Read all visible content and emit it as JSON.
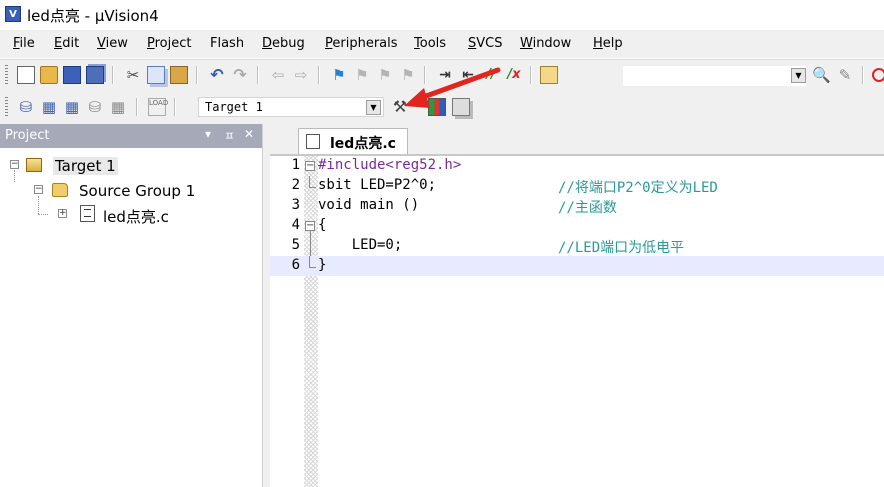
{
  "window": {
    "title": "led点亮 - µVision4",
    "icon_letter": "V"
  },
  "menu": [
    {
      "label": "File",
      "u": "F",
      "rest": "ile"
    },
    {
      "label": "Edit",
      "u": "E",
      "rest": "dit"
    },
    {
      "label": "View",
      "u": "V",
      "rest": "iew"
    },
    {
      "label": "Project",
      "u": "P",
      "rest": "roject"
    },
    {
      "label": "Flash",
      "u": "",
      "rest": "Flash"
    },
    {
      "label": "Debug",
      "u": "D",
      "rest": "ebug"
    },
    {
      "label": "Peripherals",
      "u": "P",
      "rest": "eripherals"
    },
    {
      "label": "Tools",
      "u": "T",
      "rest": "ools"
    },
    {
      "label": "SVCS",
      "u": "S",
      "rest": "VCS"
    },
    {
      "label": "Window",
      "u": "W",
      "rest": "indow"
    },
    {
      "label": "Help",
      "u": "H",
      "rest": "elp"
    }
  ],
  "toolbar2": {
    "target_value": "Target 1",
    "load_label": "LOAD"
  },
  "project_panel": {
    "title": "Project",
    "controls": {
      "menu": "▾",
      "pin": "ㅍ",
      "close": "✕"
    },
    "tree": {
      "target": "Target 1",
      "group": "Source Group 1",
      "file": "led点亮.c"
    }
  },
  "editor": {
    "tab": "led点亮.c",
    "current_line": 6,
    "lines": [
      {
        "num": "1",
        "code": "#include<reg52.h>",
        "comment": ""
      },
      {
        "num": "2",
        "code": "sbit LED=P2^0;",
        "comment": "//将端口P2^0定义为LED"
      },
      {
        "num": "3",
        "code": "void main ()",
        "comment": "//主函数"
      },
      {
        "num": "4",
        "code": "{",
        "comment": ""
      },
      {
        "num": "5",
        "code": "    LED=0;",
        "comment": "//LED端口为低电平"
      },
      {
        "num": "6",
        "code": "}",
        "comment": ""
      }
    ]
  },
  "colors": {
    "panel_header": "#a6aab8",
    "comment": "#2a9a9a",
    "current_line": "#e8eaff",
    "arrow": "#e0261f"
  }
}
